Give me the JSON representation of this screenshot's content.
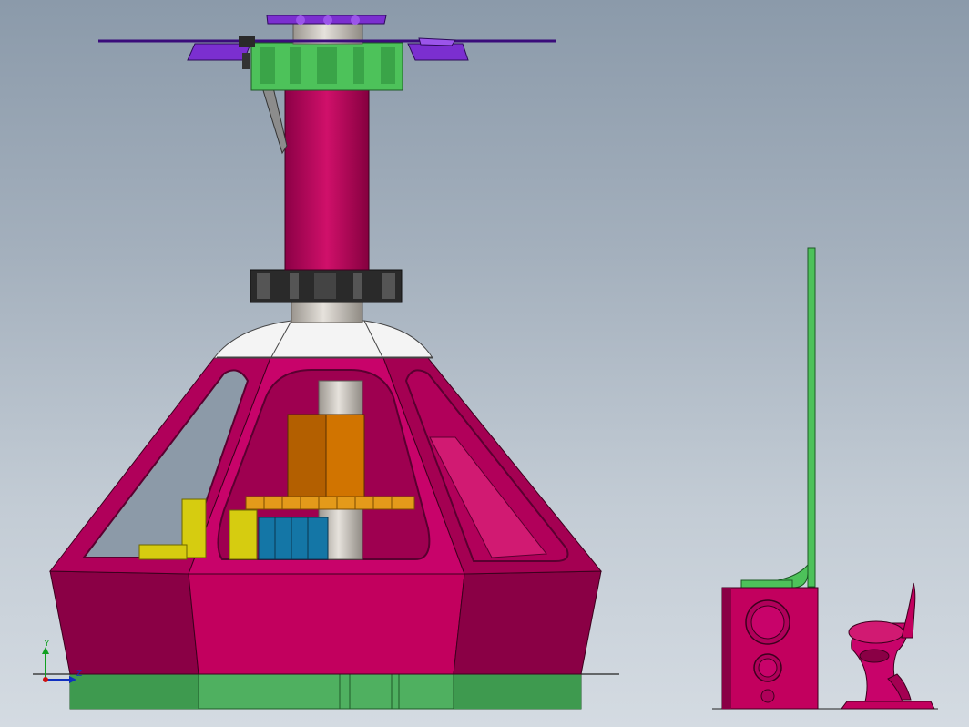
{
  "view": {
    "background_top": "#8b9aaa",
    "background_bottom": "#d4dbe2"
  },
  "triad": {
    "y_label": "Y",
    "z_label": "Z",
    "x_color": "#d01010",
    "y_color": "#10a020",
    "z_color": "#1030c0"
  },
  "colors": {
    "magenta_body": "#c2005e",
    "magenta_dark": "#8a0040",
    "green_base": "#4fb060",
    "green_gear": "#4dc25a",
    "purple_plate": "#7b2fd0",
    "gray_shaft": "#c9c4bd",
    "white_cap": "#f4f4f4",
    "orange_block": "#c86a00",
    "gold_gear": "#e49a1a",
    "yellow_parts": "#d6cc10",
    "teal_block": "#1476a6",
    "black_gear": "#2a2a2a"
  }
}
